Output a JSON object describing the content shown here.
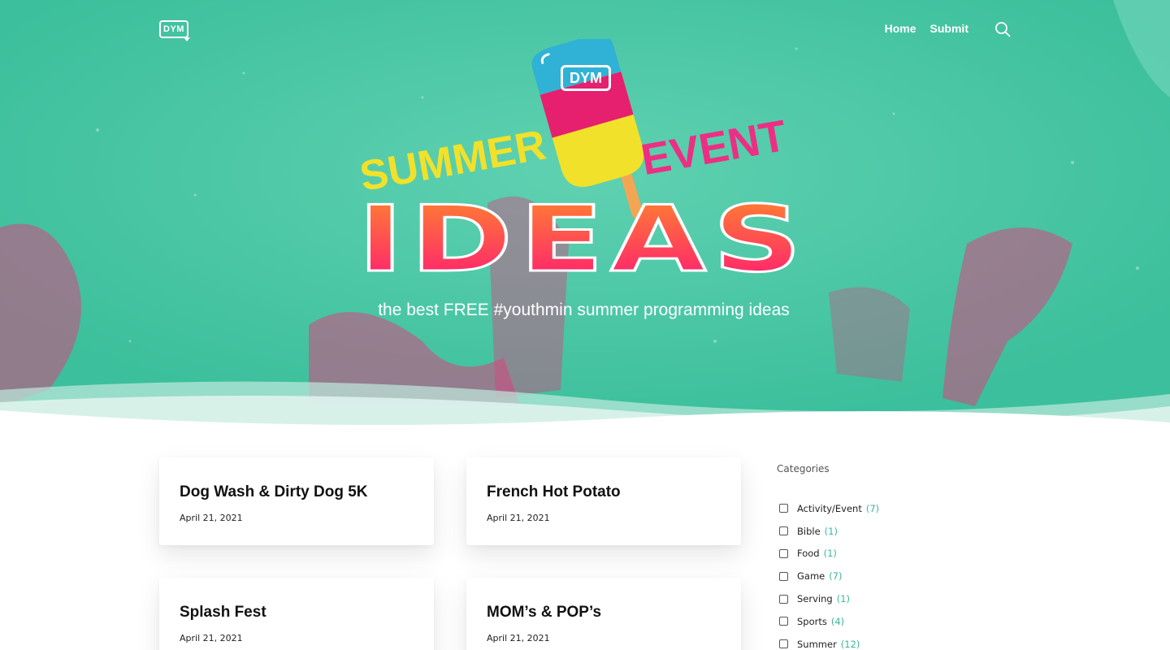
{
  "header": {
    "logo_text": "DYM",
    "nav": [
      {
        "label": "Home"
      },
      {
        "label": "Submit"
      }
    ]
  },
  "hero": {
    "logo_text": "DYM",
    "headline_top_left": "SUMMER",
    "headline_top_right": "EVENT",
    "headline_main": "IDEAS",
    "tagline": "the best FREE #youthmin summer programming ideas",
    "colors": {
      "background": "#3cbf9c",
      "splatter": "#d7457f",
      "summer_yellow": "#f1e12a",
      "event_pink": "#ec2f84",
      "ideas_top": "#ff8a2a",
      "ideas_bottom": "#ff1478"
    }
  },
  "posts": [
    {
      "title": "Dog Wash & Dirty Dog 5K",
      "date": "April 21, 2021"
    },
    {
      "title": "French Hot Potato",
      "date": "April 21, 2021"
    },
    {
      "title": "Splash Fest",
      "date": "April 21, 2021"
    },
    {
      "title": "MOM’s & POP’s",
      "date": "April 21, 2021"
    }
  ],
  "sidebar": {
    "title": "Categories",
    "categories": [
      {
        "label": "Activity/Event",
        "count": "(7)"
      },
      {
        "label": "Bible",
        "count": "(1)"
      },
      {
        "label": "Food",
        "count": "(1)"
      },
      {
        "label": "Game",
        "count": "(7)"
      },
      {
        "label": "Serving",
        "count": "(1)"
      },
      {
        "label": "Sports",
        "count": "(4)"
      },
      {
        "label": "Summer",
        "count": "(12)"
      }
    ]
  },
  "icons": {
    "search": "search-icon"
  },
  "accent_color": "#37b99a"
}
